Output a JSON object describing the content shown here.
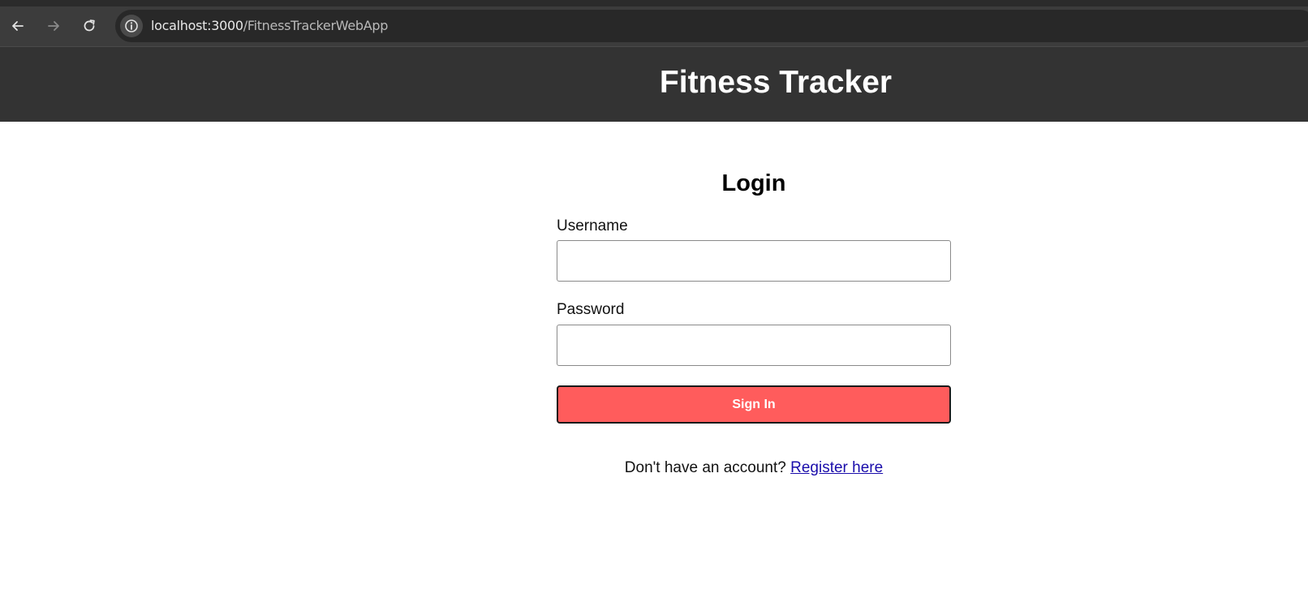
{
  "browser": {
    "url_host": "localhost:3000",
    "url_path": "/FitnessTrackerWebApp",
    "icons": [
      "back-arrow-icon",
      "forward-arrow-icon",
      "reload-icon",
      "info-icon"
    ]
  },
  "header": {
    "title": "Fitness Tracker"
  },
  "login": {
    "heading": "Login",
    "username_label": "Username",
    "username_value": "",
    "password_label": "Password",
    "password_value": "",
    "signin_label": "Sign In",
    "register_prompt": "Don't have an account?",
    "register_link": "Register here"
  },
  "colors": {
    "header_bg": "#333333",
    "button_bg": "#ff5c5c",
    "link": "#1a0dab"
  }
}
